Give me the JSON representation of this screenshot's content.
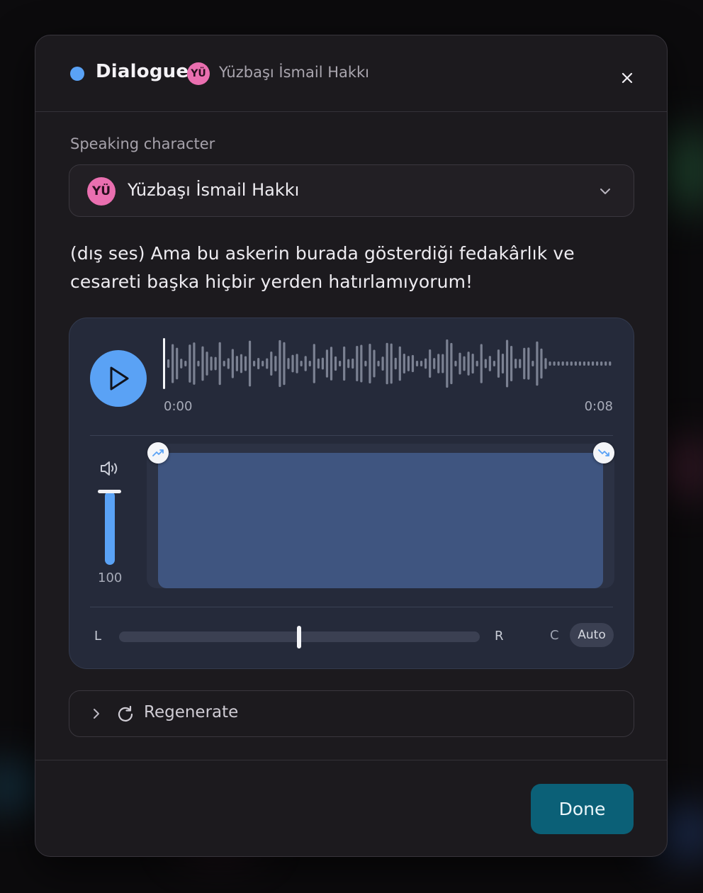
{
  "header": {
    "type_label": "Dialogue",
    "type_color": "#5aa2f5",
    "character_initials": "YÜ",
    "character_name": "Yüzbaşı İsmail Hakkı",
    "close_icon": "close-icon"
  },
  "speaking_character": {
    "label": "Speaking character",
    "selected_initials": "YÜ",
    "selected_name": "Yüzbaşı İsmail Hakkı",
    "avatar_color": "#ea6fb0"
  },
  "dialogue_text": "(dış ses) Ama bu askerin burada gösterdiği fedakârlık ve cesareti başka hiçbir yerden hatırlamıyorum!",
  "audio": {
    "play_icon": "play-icon",
    "time_start": "0:00",
    "time_end": "0:08",
    "playhead_progress": 0,
    "volume_value": "100",
    "pan_left_label": "L",
    "pan_right_label": "R",
    "pan_center_label": "C",
    "pan_auto_label": "Auto",
    "pan_position": 0.5
  },
  "regenerate": {
    "label": "Regenerate"
  },
  "footer": {
    "done_label": "Done",
    "done_color": "#0b6077"
  }
}
